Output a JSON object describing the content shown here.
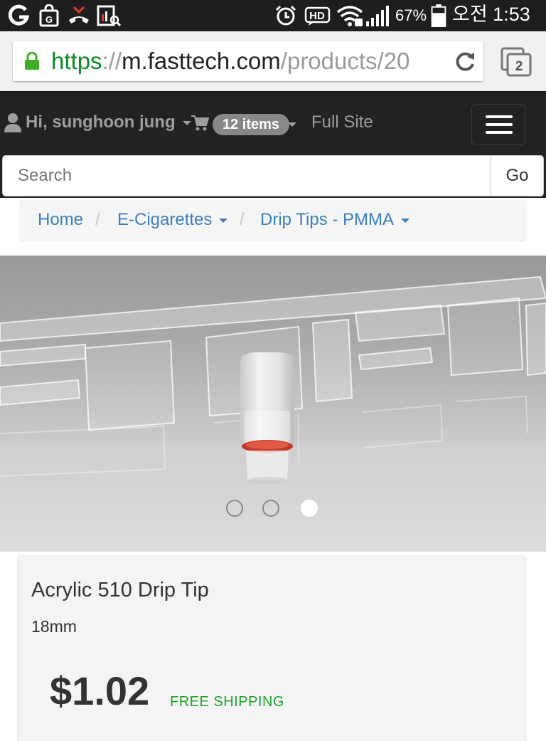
{
  "status_bar": {
    "icons_left": [
      "g-app-icon",
      "shopping-bag-icon",
      "missed-call-icon",
      "screenshot-icon"
    ],
    "icons_right": [
      "alarm-icon",
      "hd-voice-icon",
      "wifi-icon",
      "signal-icon",
      "battery-icon"
    ],
    "hd_label": "HD",
    "battery": "67%",
    "battery_level": 0.67,
    "time": "오전 1:53"
  },
  "browser": {
    "url_scheme": "https",
    "url_sep": "://",
    "url_host": "m.fasttech.com",
    "url_path": "/products/20",
    "tab_count": "2",
    "secure_color": "#3fae29"
  },
  "nav": {
    "user_label": "Hi, sunghoon jung",
    "cart_badge": "12 items",
    "full_site": "Full Site"
  },
  "search": {
    "placeholder": "Search",
    "go_label": "Go"
  },
  "breadcrumb": {
    "items": [
      "Home",
      "E-Cigarettes",
      "Drip Tips - PMMA"
    ],
    "separator": "/"
  },
  "carousel": {
    "slide_count": 3,
    "active_index": 2
  },
  "product": {
    "title": "Acrylic 510 Drip Tip",
    "subtitle": "18mm",
    "price": "$1.02",
    "shipping": "FREE SHIPPING"
  },
  "colors": {
    "link": "#3a7fc1",
    "navbar_bg": "#222222",
    "shipping_green": "#1ea32c"
  }
}
